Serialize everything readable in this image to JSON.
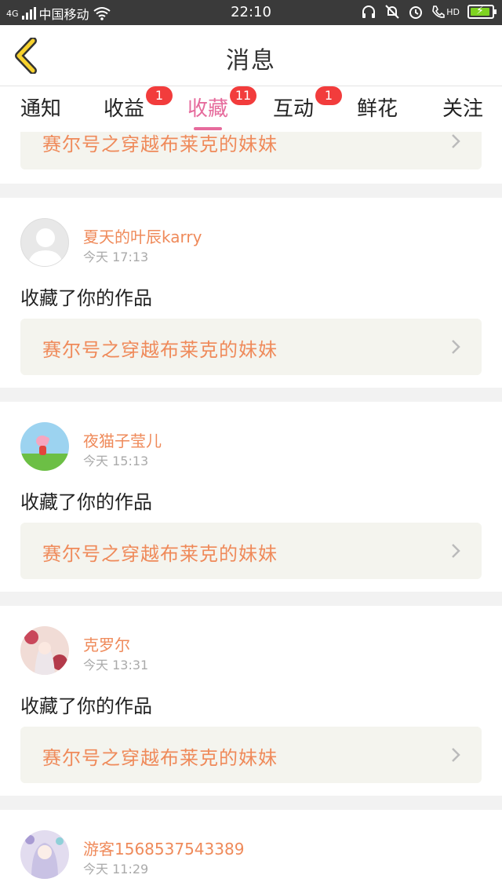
{
  "status_bar": {
    "network": "4G",
    "carrier": "中国移动",
    "time": "22:10",
    "hd": "HD"
  },
  "header": {
    "title": "消息"
  },
  "tabs": [
    {
      "label": "通知",
      "badge": ""
    },
    {
      "label": "收益",
      "badge": "1"
    },
    {
      "label": "收藏",
      "badge": "11",
      "active": true
    },
    {
      "label": "互动",
      "badge": "1"
    },
    {
      "label": "鲜花",
      "badge": ""
    },
    {
      "label": "关注",
      "badge": ""
    }
  ],
  "colors": {
    "accent": "#e66b9c",
    "name": "#ef8a5a",
    "badge": "#f23c3c"
  },
  "feed": {
    "partial_top": {
      "work_title": "赛尔号之穿越布莱克的妹妹"
    },
    "items": [
      {
        "username": "夏天的叶辰karry",
        "time": "今天 17:13",
        "action": "收藏了你的作品",
        "work_title": "赛尔号之穿越布莱克的妹妹",
        "avatar": "default-avatar-icon"
      },
      {
        "username": "夜猫子莹儿",
        "time": "今天 15:13",
        "action": "收藏了你的作品",
        "work_title": "赛尔号之穿越布莱克的妹妹",
        "avatar": "peppa-avatar-icon"
      },
      {
        "username": "克罗尔",
        "time": "今天 13:31",
        "action": "收藏了你的作品",
        "work_title": "赛尔号之穿越布莱克的妹妹",
        "avatar": "anime-girl-avatar-icon"
      },
      {
        "username": "游客1568537543389",
        "time": "今天 11:29",
        "action": "",
        "work_title": "",
        "avatar": "anime-girl-purple-avatar-icon"
      }
    ]
  }
}
